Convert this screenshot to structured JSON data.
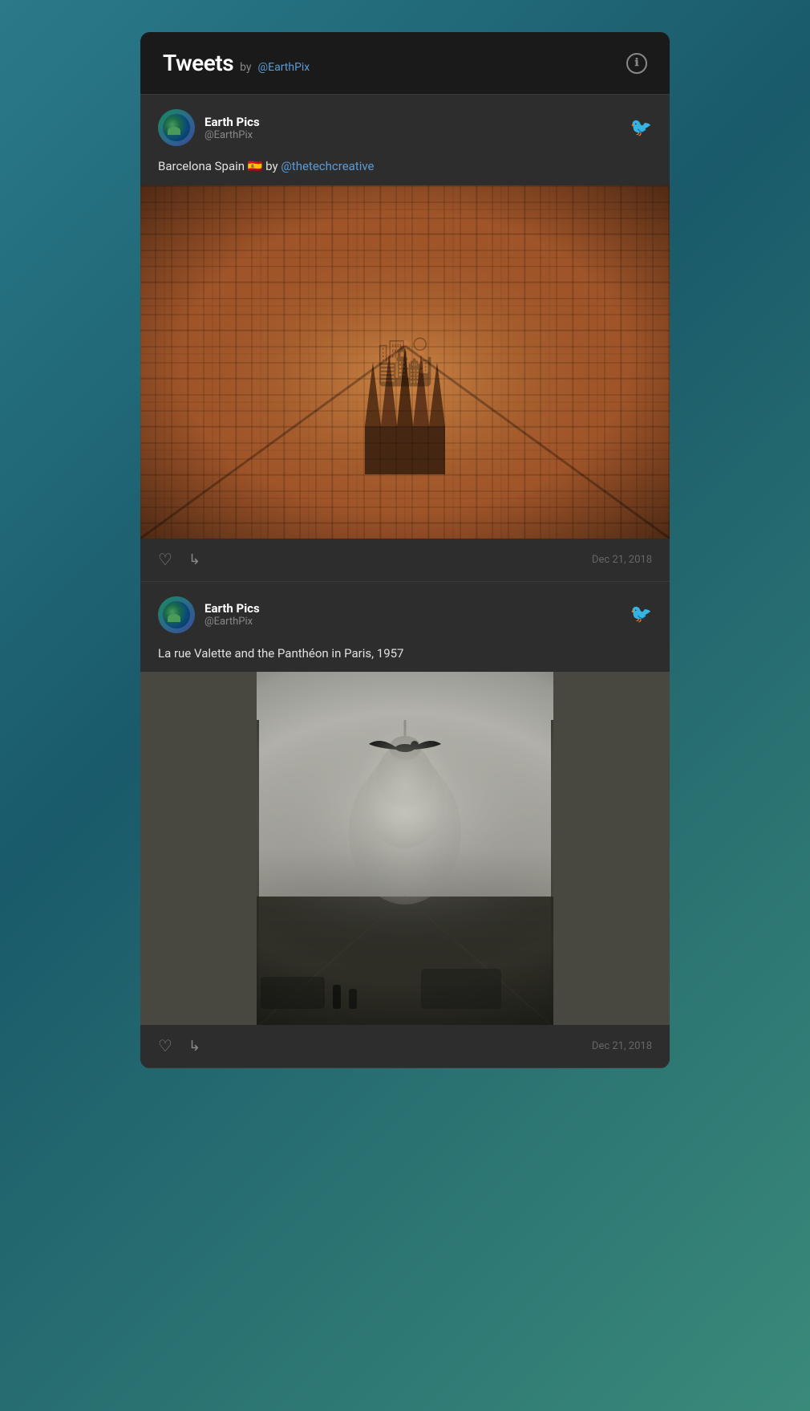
{
  "widget": {
    "header": {
      "title": "Tweets",
      "by_label": "by",
      "handle": "@EarthPix",
      "info_icon": "ℹ"
    }
  },
  "tweets": [
    {
      "id": "tweet-1",
      "user": {
        "name": "Earth Pics",
        "handle": "@EarthPix"
      },
      "text_parts": [
        {
          "type": "text",
          "content": "Barcelona Spain 🇪🇸 by "
        },
        {
          "type": "mention",
          "content": "@thetechcreative"
        }
      ],
      "text": "Barcelona Spain 🇪🇸 by @thetechcreative",
      "date": "Dec 21, 2018",
      "image_alt": "Aerial view of Barcelona Spain showing Sagrada Familia"
    },
    {
      "id": "tweet-2",
      "user": {
        "name": "Earth Pics",
        "handle": "@EarthPix"
      },
      "text": "La rue Valette and the Panthéon in Paris, 1957",
      "date": "Dec 21, 2018",
      "image_alt": "Black and white photo of La rue Valette and the Panthéon in Paris, 1957"
    }
  ],
  "actions": {
    "like_label": "♡",
    "share_label": "↳"
  }
}
